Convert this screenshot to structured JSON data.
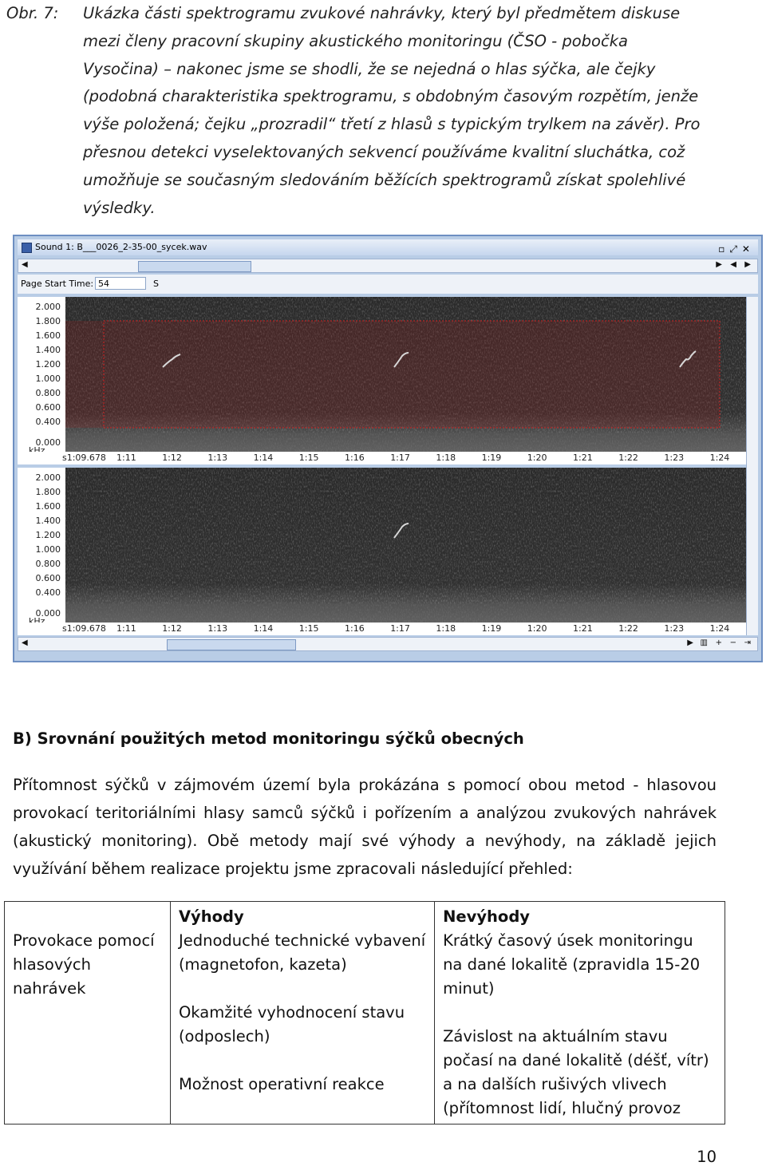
{
  "caption": {
    "label": "Obr. 7:",
    "lines": [
      "Ukázka části spektrogramu zvukové nahrávky, který byl předmětem diskuse",
      "mezi členy pracovní skupiny akustického monitoringu (ČSO - pobočka",
      "Vysočina) – nakonec jsme se shodli, že se nejedná o hlas sýčka, ale čejky",
      "(podobná charakteristika spektrogramu, s obdobným časovým rozpětím, jenže",
      "výše položená; čejku „prozradil“ třetí z hlasů s typickým trylkem na závěr). Pro",
      "přesnou detekci vyselektovaných sekvencí používáme kvalitní sluchátka, což",
      "umožňuje se současným sledováním běžících spektrogramů získat spolehlivé",
      "výsledky."
    ]
  },
  "app": {
    "title": "Sound 1: B___0026_2-35-00_sycek.wav",
    "page_start_label": "Page Start Time:",
    "page_start_value": "54",
    "page_start_unit": "S",
    "y_ticks": [
      "2.000",
      "1.800",
      "1.600",
      "1.400",
      "1.200",
      "1.000",
      "0.800",
      "0.600",
      "0.400",
      "0.000"
    ],
    "y_unit": "kHz",
    "x_ticks": [
      "s1:09.678",
      "1:11",
      "1:12",
      "1:13",
      "1:14",
      "1:15",
      "1:16",
      "1:17",
      "1:18",
      "1:19",
      "1:20",
      "1:21",
      "1:22",
      "1:23",
      "1:24"
    ],
    "selection_color": "#d02020"
  },
  "section": {
    "title": "B) Srovnání použitých metod monitoringu sýčků obecných"
  },
  "paragraph": {
    "lines": [
      "Přítomnost sýčků v zájmovém území byla prokázána s pomocí obou metod - hlasovou",
      "provokací teritoriálními hlasy samců sýčků i pořízením a analýzou zvukových nahrávek",
      "(akustický monitoring).  Obě metody mají své výhody a nevýhody, na základě jejich",
      "využívání během realizace projektu jsme zpracovali následující přehled:"
    ]
  },
  "table": {
    "row_label": "Provokace pomocí hlasových nahrávek",
    "col_adv": "Výhody",
    "col_dis": "Nevýhody",
    "adv": [
      "Jednoduché technické vybavení (magnetofon, kazeta)",
      "Okamžité vyhodnocení stavu (odposlech)",
      "Možnost operativní reakce"
    ],
    "dis": [
      "Krátký časový úsek monitoringu na dané lokalitě (zpravidla 15-20 minut)",
      "Závislost na aktuálním stavu počasí na dané lokalitě (déšť, vítr) a na dalších rušivých vlivech (přítomnost lidí, hlučný provoz"
    ]
  },
  "page_number": "10"
}
